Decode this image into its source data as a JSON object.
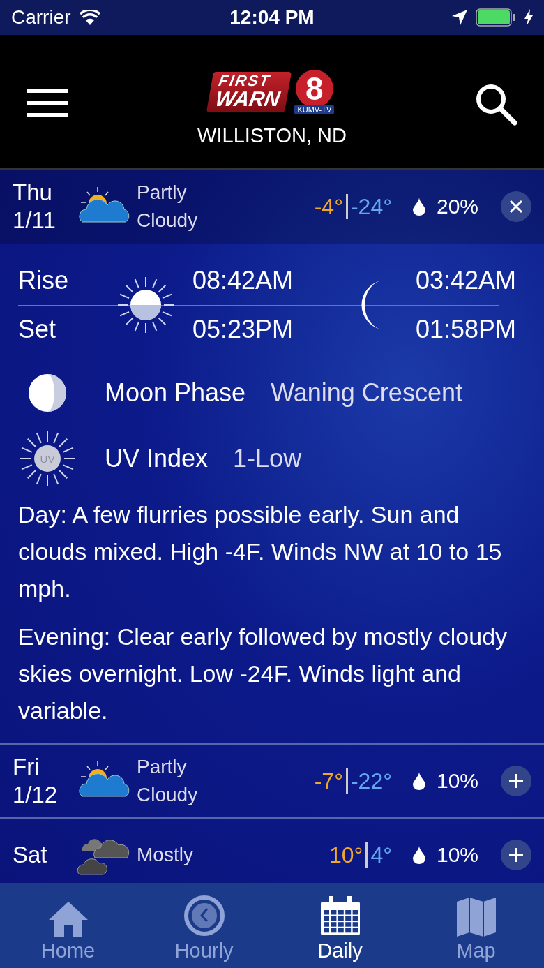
{
  "status_bar": {
    "carrier": "Carrier",
    "time": "12:04 PM"
  },
  "header": {
    "logo": {
      "line_1": "FIRST",
      "line_2": "WARN",
      "channel": "8",
      "station": "KUMV-TV"
    },
    "location": "WILLISTON, ND"
  },
  "days": [
    {
      "day": "Thu",
      "date": "1/11",
      "kind": "partly-cloudy",
      "condition": "Partly Cloudy",
      "high": "-4°",
      "low": "-24°",
      "precip": "20%",
      "expanded": true
    },
    {
      "day": "Fri",
      "date": "1/12",
      "kind": "partly-cloudy",
      "condition": "Partly Cloudy",
      "high": "-7°",
      "low": "-22°",
      "precip": "10%",
      "expanded": false
    },
    {
      "day": "Sat",
      "kind": "mostly-cloudy",
      "condition": "Mostly",
      "high": "10°",
      "low": "4°",
      "precip": "10%",
      "expanded": false
    }
  ],
  "detail": {
    "rise_label": "Rise",
    "set_label": "Set",
    "sunrise": "08:42AM",
    "sunset": "05:23PM",
    "moonrise": "03:42AM",
    "moonset": "01:58PM",
    "moon_phase_label": "Moon Phase",
    "moon_phase": "Waning Crescent",
    "uv_icon_text": "UV",
    "uv_label": "UV Index",
    "uv_value": "1-Low",
    "paragraphs": [
      "Day: A few flurries possible early. Sun and clouds mixed. High -4F. Winds NW at 10 to 15 mph.",
      "Evening: Clear early followed by mostly cloudy skies overnight. Low -24F. Winds light and variable."
    ]
  },
  "tabs": [
    {
      "label": "Home",
      "kind": "home",
      "selected": false
    },
    {
      "label": "Hourly",
      "kind": "clock",
      "selected": false
    },
    {
      "label": "Daily",
      "kind": "calendar",
      "selected": true
    },
    {
      "label": "Map",
      "kind": "map",
      "selected": false
    }
  ]
}
